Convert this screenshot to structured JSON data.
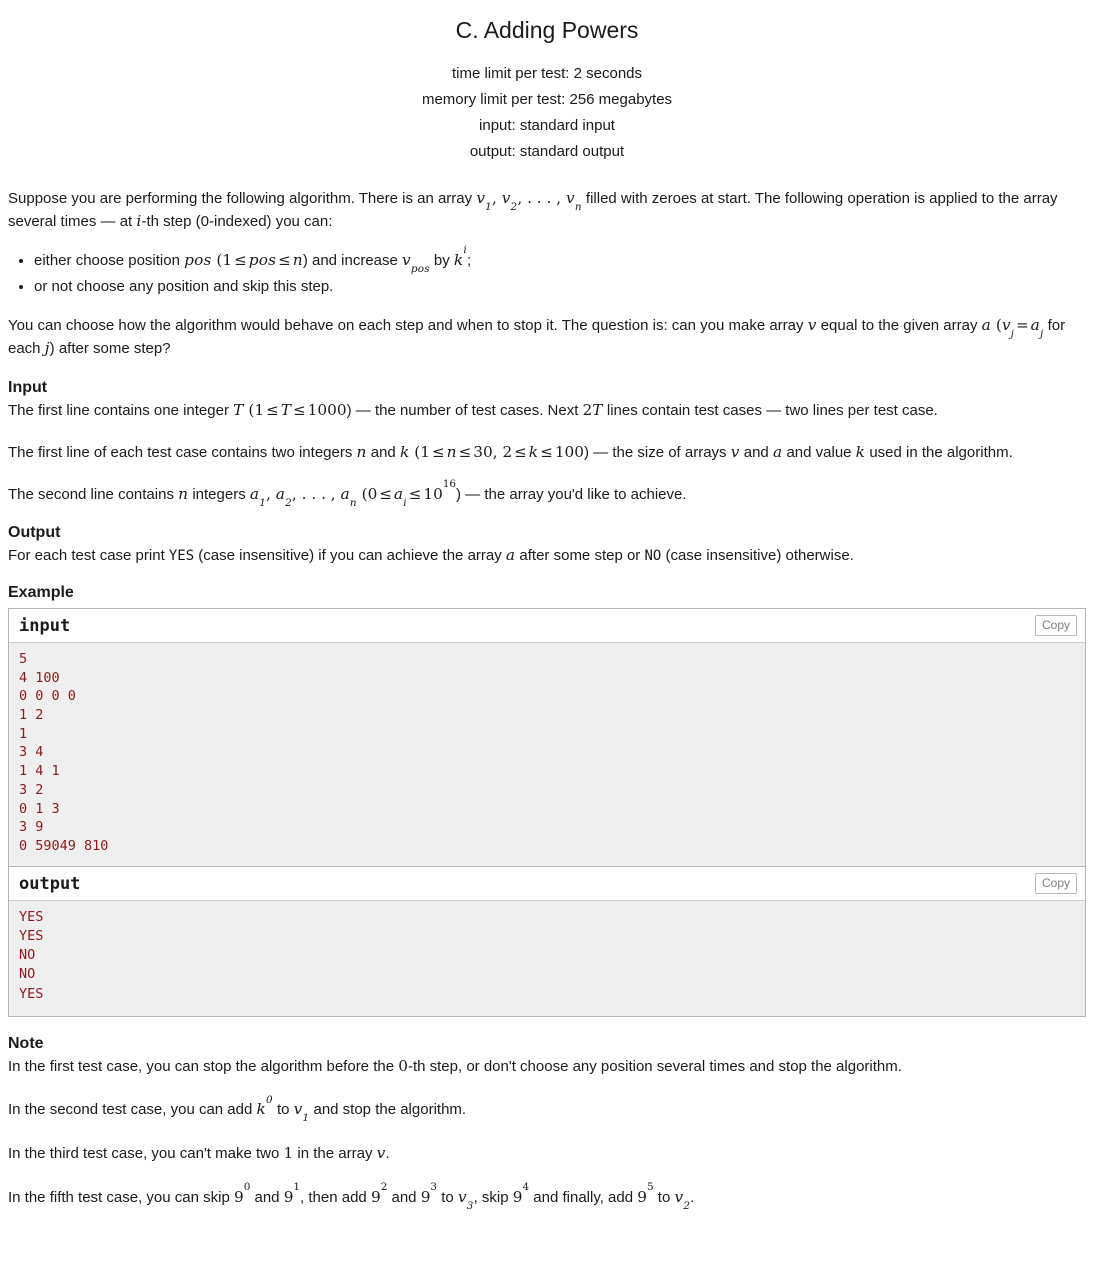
{
  "problem": {
    "title": "C. Adding Powers",
    "limits": [
      "time limit per test: 2 seconds",
      "memory limit per test: 256 megabytes",
      "input: standard input",
      "output: standard output"
    ]
  },
  "statement": {
    "p1_a": "Suppose you are performing the following algorithm. There is an array ",
    "p1_v1": "v",
    "p1_v1_sub": "1",
    "p1_comma1": ", ",
    "p1_v2": "v",
    "p1_v2_sub": "2",
    "p1_dots": ", . . . , ",
    "p1_vn": "v",
    "p1_vn_sub": "n",
    "p1_b": " filled with zeroes at start. The following operation is applied to the array several times — at ",
    "p1_i": "i",
    "p1_c": "-th step (0-indexed) you can:",
    "bullet1_a": "either choose position ",
    "bullet1_pos": "pos",
    "bullet1_open": " (",
    "bullet1_one": "1",
    "bullet1_le1": "≤",
    "bullet1_pos2": "pos",
    "bullet1_le2": "≤",
    "bullet1_n": "n",
    "bullet1_close": ") and increase ",
    "bullet1_v": "v",
    "bullet1_v_sub": "pos",
    "bullet1_by": " by ",
    "bullet1_k": "k",
    "bullet1_k_sup": "i",
    "bullet1_semi": ";",
    "bullet2": "or not choose any position and skip this step.",
    "p2_a": "You can choose how the algorithm would behave on each step and when to stop it. The question is: can you make array ",
    "p2_v": "v",
    "p2_b": " equal to the given array ",
    "p2_a_var": "a",
    "p2_open": " (",
    "p2_vj": "v",
    "p2_vj_sub": "j",
    "p2_eq": "=",
    "p2_aj": "a",
    "p2_aj_sub": "j",
    "p2_foreach": " for each ",
    "p2_j": "j",
    "p2_c": ") after some step?"
  },
  "input_section": {
    "heading": "Input",
    "p1_a": "The first line contains one integer ",
    "p1_T": "T",
    "p1_open": " (",
    "p1_one": "1",
    "p1_le1": "≤",
    "p1_T2": "T",
    "p1_le2": "≤",
    "p1_1000": "1000",
    "p1_b": ") — the number of test cases. Next ",
    "p1_2": "2",
    "p1_T3": "T",
    "p1_c": " lines contain test cases — two lines per test case.",
    "p2_a": "The first line of each test case contains two integers ",
    "p2_n": "n",
    "p2_and": " and ",
    "p2_k": "k",
    "p2_open": " (",
    "p2_one": "1",
    "p2_le1": "≤",
    "p2_n2": "n",
    "p2_le2": "≤",
    "p2_30": "30",
    "p2_comma": ", ",
    "p2_two": "2",
    "p2_le3": "≤",
    "p2_k2": "k",
    "p2_le4": "≤",
    "p2_100": "100",
    "p2_b": ") — the size of arrays ",
    "p2_v": "v",
    "p2_and2": " and ",
    "p2_a_var": "a",
    "p2_c": " and value ",
    "p2_k3": "k",
    "p2_d": " used in the algorithm.",
    "p3_a": "The second line contains ",
    "p3_n": "n",
    "p3_b": " integers ",
    "p3_a1": "a",
    "p3_a1_sub": "1",
    "p3_comma1": ", ",
    "p3_a2": "a",
    "p3_a2_sub": "2",
    "p3_dots": ", . . . , ",
    "p3_an": "a",
    "p3_an_sub": "n",
    "p3_open": " (",
    "p3_zero": "0",
    "p3_le1": "≤",
    "p3_ai": "a",
    "p3_ai_sub": "i",
    "p3_le2": "≤",
    "p3_ten": "10",
    "p3_ten_sup": "16",
    "p3_c": ") — the array you'd like to achieve."
  },
  "output_section": {
    "heading": "Output",
    "p_a": "For each test case print ",
    "p_yes": "YES",
    "p_b": " (case insensitive) if you can achieve the array ",
    "p_a_var": "a",
    "p_c": " after some step or ",
    "p_no": "NO",
    "p_d": " (case insensitive) otherwise."
  },
  "example_section": {
    "heading": "Example",
    "copy_label": "Copy",
    "input_title": "input",
    "output_title": "output",
    "input_text": "5\n4 100\n0 0 0 0\n1 2\n1\n3 4\n1 4 1\n3 2\n0 1 3\n3 9\n0 59049 810",
    "output_text": "YES\nYES\nNO\nNO\nYES"
  },
  "note_section": {
    "heading": "Note",
    "n1_a": "In the first test case, you can stop the algorithm before the ",
    "n1_zero": "0",
    "n1_b": "-th step, or don't choose any position several times and stop the algorithm.",
    "n2_a": "In the second test case, you can add ",
    "n2_k": "k",
    "n2_k_sup": "0",
    "n2_to": " to ",
    "n2_v": "v",
    "n2_v_sub": "1",
    "n2_b": " and stop the algorithm.",
    "n3_a": "In the third test case, you can't make two ",
    "n3_one": "1",
    "n3_b": " in the array ",
    "n3_v": "v",
    "n3_c": ".",
    "n5_a": "In the fifth test case, you can skip ",
    "n5_90": "9",
    "n5_90_sup": "0",
    "n5_and1": " and ",
    "n5_91": "9",
    "n5_91_sup": "1",
    "n5_b": ", then add ",
    "n5_92": "9",
    "n5_92_sup": "2",
    "n5_and2": " and ",
    "n5_93": "9",
    "n5_93_sup": "3",
    "n5_to1": " to ",
    "n5_v3": "v",
    "n5_v3_sub": "3",
    "n5_c": ", skip ",
    "n5_94": "9",
    "n5_94_sup": "4",
    "n5_d": " and finally, add ",
    "n5_95": "9",
    "n5_95_sup": "5",
    "n5_to2": " to ",
    "n5_v2": "v",
    "n5_v2_sub": "2",
    "n5_e": "."
  },
  "colors": {
    "sample_code": "#8b1a1a",
    "sample_bg": "#efefef",
    "border": "#b5b5b5",
    "text": "#1b1b1b"
  }
}
